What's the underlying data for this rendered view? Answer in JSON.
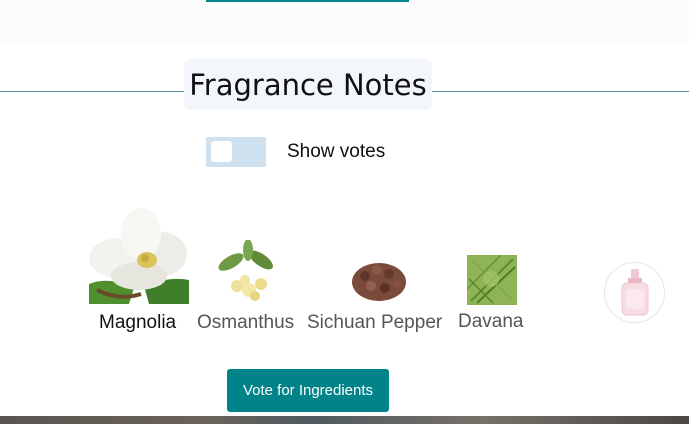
{
  "section": {
    "title": "Fragrance Notes"
  },
  "toggle": {
    "label": "Show votes",
    "checked": false
  },
  "notes": [
    {
      "label": "Magnolia",
      "icon": "magnolia-image"
    },
    {
      "label": "Osmanthus",
      "icon": "osmanthus-image"
    },
    {
      "label": "Sichuan Pepper",
      "icon": "sichuan-pepper-image"
    },
    {
      "label": "Davana",
      "icon": "davana-image"
    }
  ],
  "perfume_icon": "perfume-bottle-image",
  "vote_button": {
    "label": "Vote for Ingredients"
  },
  "colors": {
    "accent": "#00848a",
    "toggle_track": "#cfe1ef",
    "heading_bg": "#f3f7fb"
  }
}
